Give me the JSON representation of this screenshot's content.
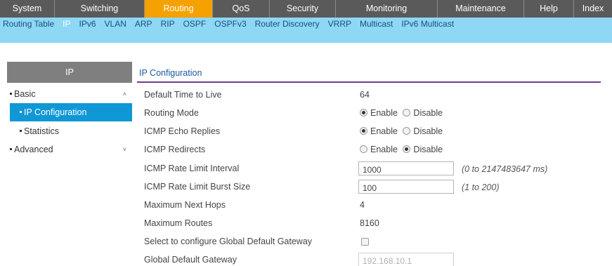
{
  "topnav": {
    "tabs": [
      {
        "label": "System",
        "active": false
      },
      {
        "label": "Switching",
        "active": false
      },
      {
        "label": "Routing",
        "active": true
      },
      {
        "label": "QoS",
        "active": false
      },
      {
        "label": "Security",
        "active": false
      },
      {
        "label": "Monitoring",
        "active": false
      },
      {
        "label": "Maintenance",
        "active": false
      },
      {
        "label": "Help",
        "active": false
      },
      {
        "label": "Index",
        "active": false
      }
    ]
  },
  "subnav": {
    "items": [
      {
        "label": "Routing Table",
        "active": false
      },
      {
        "label": "IP",
        "active": true
      },
      {
        "label": "IPv6",
        "active": false
      },
      {
        "label": "VLAN",
        "active": false
      },
      {
        "label": "ARP",
        "active": false
      },
      {
        "label": "RIP",
        "active": false
      },
      {
        "label": "OSPF",
        "active": false
      },
      {
        "label": "OSPFv3",
        "active": false
      },
      {
        "label": "Router Discovery",
        "active": false
      },
      {
        "label": "VRRP",
        "active": false
      },
      {
        "label": "Multicast",
        "active": false
      },
      {
        "label": "IPv6 Multicast",
        "active": false
      }
    ]
  },
  "sidebar": {
    "header": "IP",
    "items": [
      {
        "label": "Basic",
        "expanded": true
      },
      {
        "label": "IP Configuration",
        "active": true
      },
      {
        "label": "Statistics"
      },
      {
        "label": "Advanced",
        "expanded": false
      }
    ]
  },
  "content": {
    "title": "IP Configuration",
    "fields": {
      "ttl": {
        "label": "Default Time to Live",
        "value": "64"
      },
      "routing_mode": {
        "label": "Routing Mode",
        "opt1": "Enable",
        "opt2": "Disable",
        "selected": "Enable"
      },
      "icmp_echo": {
        "label": "ICMP Echo Replies",
        "opt1": "Enable",
        "opt2": "Disable",
        "selected": "Enable"
      },
      "icmp_redirects": {
        "label": "ICMP Redirects",
        "opt1": "Enable",
        "opt2": "Disable",
        "selected": "Disable"
      },
      "rate_interval": {
        "label": "ICMP Rate Limit Interval",
        "value": "1000",
        "hint": "(0 to 2147483647 ms)"
      },
      "rate_burst": {
        "label": "ICMP Rate Limit Burst Size",
        "value": "100",
        "hint": "(1 to 200)"
      },
      "max_next_hops": {
        "label": "Maximum Next Hops",
        "value": "4"
      },
      "max_routes": {
        "label": "Maximum Routes",
        "value": "8160"
      },
      "global_gw_select": {
        "label": "Select to configure Global Default Gateway",
        "checked": false
      },
      "global_gw": {
        "label": "Global Default Gateway",
        "value": "192.168.10.1"
      }
    }
  },
  "colors": {
    "topnav_bg": "#5a5a5a",
    "topnav_active": "#f5a100",
    "subnav_bg": "#8ed7f5",
    "sidebar_active": "#0f97d6",
    "title_rule": "#6a3f8f"
  }
}
